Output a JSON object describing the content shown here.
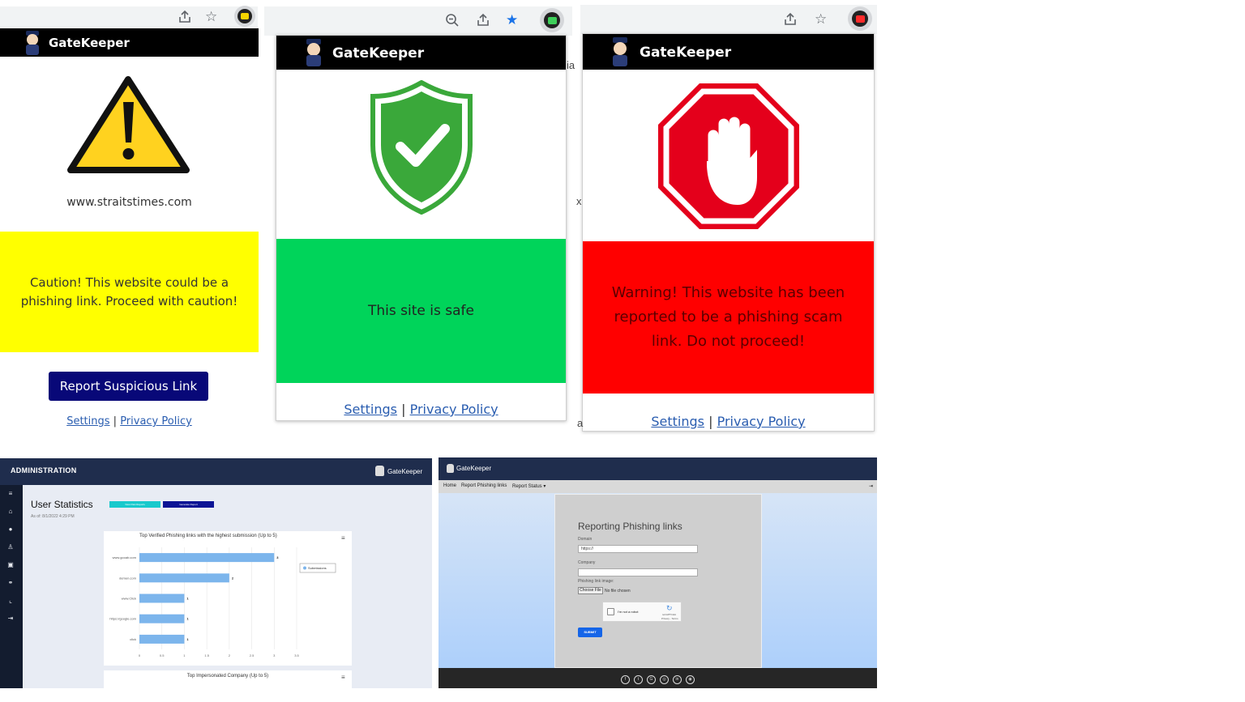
{
  "popup_warning": {
    "brand": "GateKeeper",
    "domain": "www.straitstimes.com",
    "message": "Caution! This website could be a phishing link. Proceed with caution!",
    "report_button": "Report Suspicious Link",
    "settings_link": "Settings",
    "separator": "|",
    "privacy_link": "Privacy Policy",
    "icon": "warning-triangle-icon",
    "color": "#ffff00"
  },
  "popup_safe": {
    "brand": "GateKeeper",
    "message": "This site is safe",
    "settings_link": "Settings",
    "separator": "|",
    "privacy_link": "Privacy Policy",
    "icon": "shield-check-icon",
    "color": "#00d45a"
  },
  "popup_danger": {
    "brand": "GateKeeper",
    "message": "Warning! This website has been reported to be a phishing scam link. Do not proceed!",
    "settings_link": "Settings",
    "separator": "|",
    "privacy_link": "Privacy Policy",
    "icon": "stop-hand-icon",
    "color": "#ff0000"
  },
  "bg_fragments": {
    "a": "ia",
    "b": "x",
    "c": "a"
  },
  "admin": {
    "header": "ADMINISTRATION",
    "brand": "GateKeeper",
    "page_title": "User Statistics",
    "btn_view_past": "View Past Reports",
    "btn_generate": "Generate Report",
    "as_of": "As of: 8/1/2022 4:29 PM",
    "chart_title": "Top Verified Phishing links with the highest submission (Up to 5)",
    "legend": "Submissions",
    "second_chart_title": "Top Impersonated Company (Up to 5)",
    "sidebar_icons": [
      "menu-icon",
      "home-icon",
      "info-icon",
      "user-icon",
      "lock-icon",
      "link-icon",
      "chart-icon",
      "logout-icon"
    ]
  },
  "chart_data": {
    "type": "bar",
    "orientation": "horizontal",
    "title": "Top Verified Phishing links with the highest submission (Up to 5)",
    "categories": [
      "www.gooab.com",
      "demen.com",
      "www.Click",
      "https://google.com",
      "click"
    ],
    "series": [
      {
        "name": "Submissions",
        "values": [
          3,
          2,
          1,
          1,
          1
        ]
      }
    ],
    "xticks": [
      "0",
      "0.5",
      "1",
      "1.5",
      "2",
      "2.5",
      "3",
      "3.5"
    ],
    "xlim": [
      0,
      3.5
    ],
    "grid": true,
    "legend": "right"
  },
  "report_page": {
    "brand": "GateKeeper",
    "nav": [
      "Home",
      "Report Phishing links",
      "Report Status ▾"
    ],
    "title": "Reporting Phishing links",
    "domain_label": "Domain",
    "domain_value": "https:// ",
    "company_label": "Company",
    "image_label": "Phishing link image:",
    "choose_file": "Choose File",
    "no_file": "No file chosen",
    "captcha_label": "I'm not a robot",
    "captcha_brand": "reCAPTCHA",
    "captcha_terms": "Privacy - Terms",
    "submit": "SUBMIT",
    "social_icons": [
      "facebook-icon",
      "twitter-icon",
      "google-icon",
      "instagram-icon",
      "linkedin-icon",
      "github-icon"
    ]
  }
}
